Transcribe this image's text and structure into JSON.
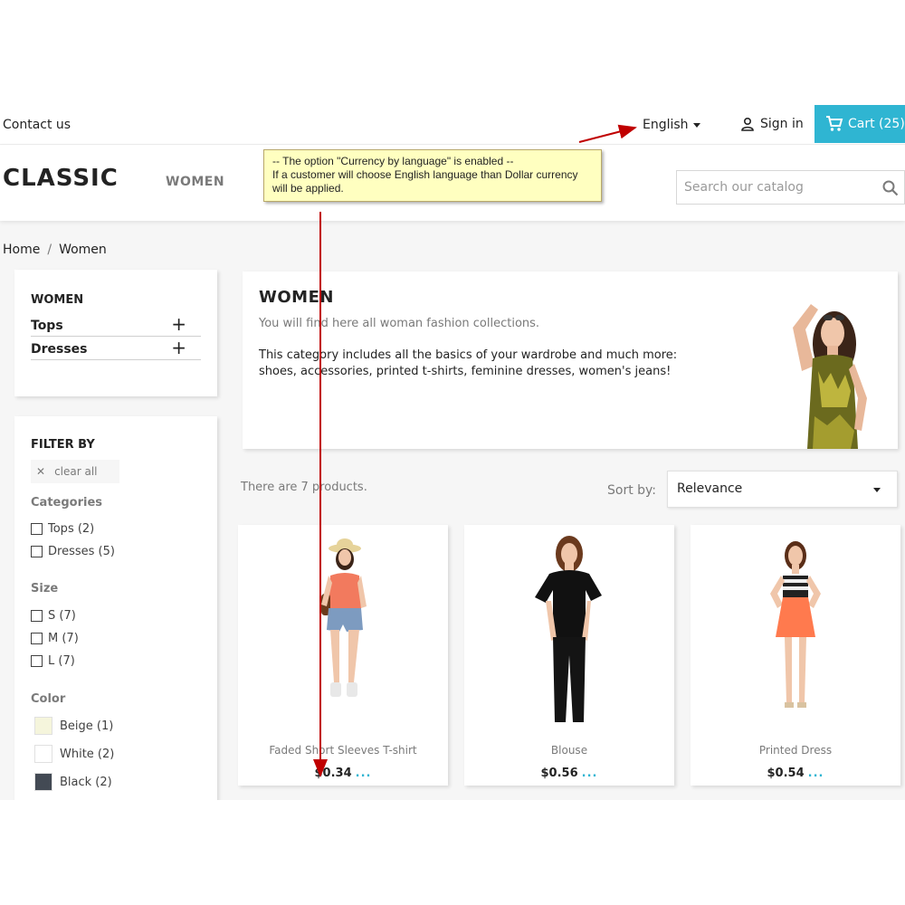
{
  "header": {
    "contact_label": "Contact us",
    "language_label": "English",
    "signin_label": "Sign in",
    "cart_label": "Cart (25)"
  },
  "nav": {
    "logo": "CLASSIC",
    "menu_women": "WOMEN",
    "search_placeholder": "Search our catalog"
  },
  "breadcrumb": {
    "home": "Home",
    "separator": "/",
    "current": "Women"
  },
  "category_block": {
    "title": "WOMEN",
    "items": [
      {
        "label": "Tops",
        "expand": "+"
      },
      {
        "label": "Dresses",
        "expand": "+"
      }
    ]
  },
  "filter": {
    "title": "FILTER BY",
    "clear_all": "clear all",
    "categories": {
      "title": "Categories",
      "items": [
        "Tops (2)",
        "Dresses (5)"
      ]
    },
    "size": {
      "title": "Size",
      "items": [
        "S (7)",
        "M (7)",
        "L (7)"
      ]
    },
    "color": {
      "title": "Color",
      "items": [
        {
          "label": "Beige (1)",
          "swatch": "#f5f5dc"
        },
        {
          "label": "White (2)",
          "swatch": "#ffffff"
        },
        {
          "label": "Black (2)",
          "swatch": "#434a54"
        }
      ]
    }
  },
  "category_hero": {
    "title": "WOMEN",
    "subtitle": "You will find here all woman fashion collections.",
    "description": "This category includes all the basics of your wardrobe and much more: shoes, accessories, printed t-shirts, feminine dresses, women's jeans!"
  },
  "listing": {
    "count_text": "There are 7 products.",
    "sort_label": "Sort by:",
    "sort_value": "Relevance"
  },
  "products": [
    {
      "name": "Faded Short Sleeves T-shirt",
      "price": "$0.34",
      "more": "..."
    },
    {
      "name": "Blouse",
      "price": "$0.56",
      "more": "..."
    },
    {
      "name": "Printed Dress",
      "price": "$0.54",
      "more": "..."
    }
  ],
  "annotation": {
    "line1": "-- The option \"Currency by language\" is enabled --",
    "line2": "If a customer will choose English language than Dollar currency will be applied."
  },
  "colors": {
    "accent": "#2fb5d2",
    "note_bg": "#ffffc0",
    "arrow": "#c00000"
  }
}
